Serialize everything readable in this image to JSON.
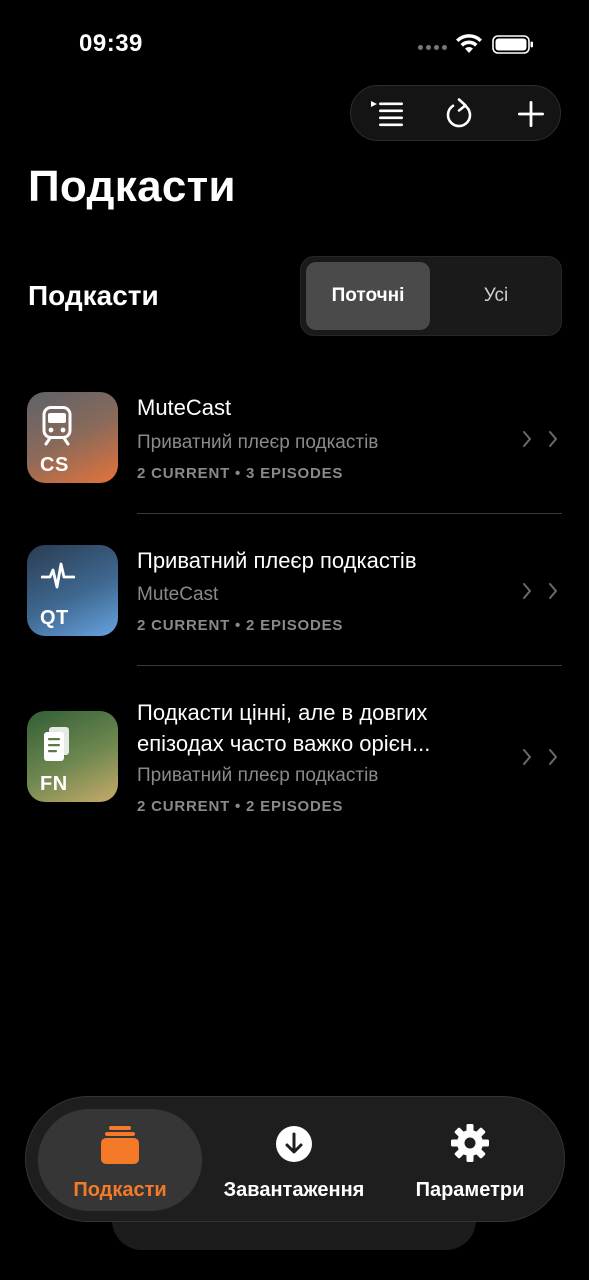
{
  "status": {
    "time": "09:39"
  },
  "page": {
    "title": "Подкасти"
  },
  "section": {
    "title": "Подкасти"
  },
  "segmented": {
    "current": "Поточні",
    "all": "Усі"
  },
  "podcasts": [
    {
      "abbr": "CS",
      "icon": "train-icon",
      "title": "MuteCast",
      "subtitle": "Приватний плеєр подкастів",
      "meta": "2 CURRENT • 3 EPISODES",
      "colors": [
        "#6b6e73",
        "#e2733a"
      ]
    },
    {
      "abbr": "QT",
      "icon": "waveform-icon",
      "title": "Приватний плеєр подкастів",
      "subtitle": "MuteCast",
      "meta": "2 CURRENT • 2 EPISODES",
      "colors": [
        "#2b3f55",
        "#5f9ad8"
      ]
    },
    {
      "abbr": "FN",
      "icon": "notes-icon",
      "title_line1": "Подкасти цінні, але в довгих",
      "title_line2": "епізодах часто важко орієн...",
      "subtitle": "Приватний плеєр подкастів",
      "meta": "2 CURRENT • 2 EPISODES",
      "colors": [
        "#3d6b3a",
        "#c9ad6a"
      ]
    }
  ],
  "tabs": [
    {
      "label": "Подкасти",
      "icon": "podcasts-stack-icon",
      "active": true
    },
    {
      "label": "Завантаження",
      "icon": "download-icon",
      "active": false
    },
    {
      "label": "Параметри",
      "icon": "gear-icon",
      "active": false
    }
  ],
  "theme": {
    "accent": "#f47a2a",
    "background": "#000000",
    "secondary_text": "#8a8a8a"
  }
}
